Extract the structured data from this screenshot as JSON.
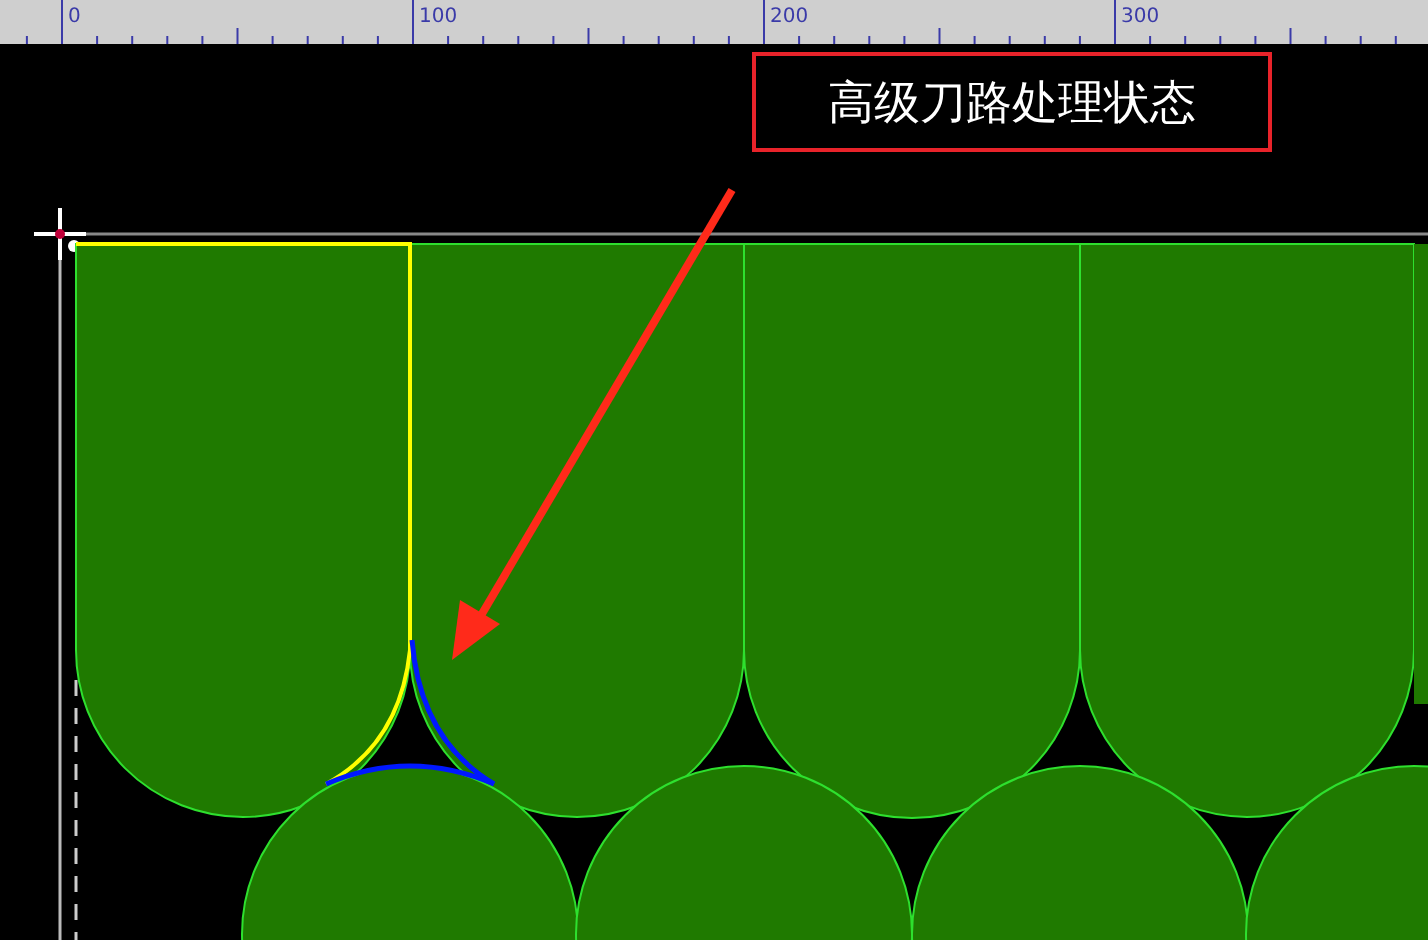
{
  "ruler": {
    "labels": [
      "0",
      "100",
      "200",
      "300"
    ]
  },
  "annotation": {
    "text": "高级刀路处理状态"
  }
}
